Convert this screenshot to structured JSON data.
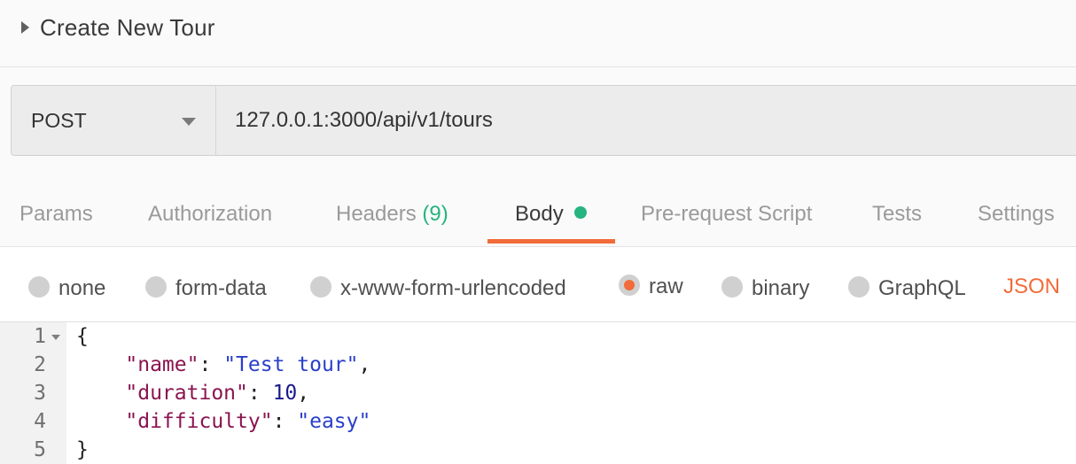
{
  "request": {
    "name": "Create New Tour",
    "method": "POST",
    "url": "127.0.0.1:3000/api/v1/tours"
  },
  "tabs": [
    {
      "label": "Params"
    },
    {
      "label": "Authorization"
    },
    {
      "label": "Headers",
      "count": "(9)"
    },
    {
      "label": "Body",
      "active": true,
      "indicator": "green-dot"
    },
    {
      "label": "Pre-request Script"
    },
    {
      "label": "Tests"
    },
    {
      "label": "Settings"
    }
  ],
  "body_options": [
    {
      "label": "none",
      "selected": false
    },
    {
      "label": "form-data",
      "selected": false
    },
    {
      "label": "x-www-form-urlencoded",
      "selected": false
    },
    {
      "label": "raw",
      "selected": true
    },
    {
      "label": "binary",
      "selected": false
    },
    {
      "label": "GraphQL",
      "selected": false
    }
  ],
  "body_type": "JSON",
  "editor": {
    "line_numbers": [
      "1",
      "2",
      "3",
      "4",
      "5"
    ],
    "lines": [
      {
        "open": "{"
      },
      {
        "indent": "    ",
        "key": "\"name\"",
        "sep": ": ",
        "value": "\"Test tour\"",
        "end": ","
      },
      {
        "indent": "    ",
        "key": "\"duration\"",
        "sep": ": ",
        "value": "10",
        "end": ","
      },
      {
        "indent": "    ",
        "key": "\"difficulty\"",
        "sep": ": ",
        "value": "\"easy\"",
        "end": ""
      },
      {
        "close": "}"
      }
    ]
  },
  "colors": {
    "accent": "#f26b3a",
    "green": "#26b47f",
    "json_key": "#8a1450",
    "json_string": "#2a3fc9",
    "json_number": "#1a1a8a"
  }
}
